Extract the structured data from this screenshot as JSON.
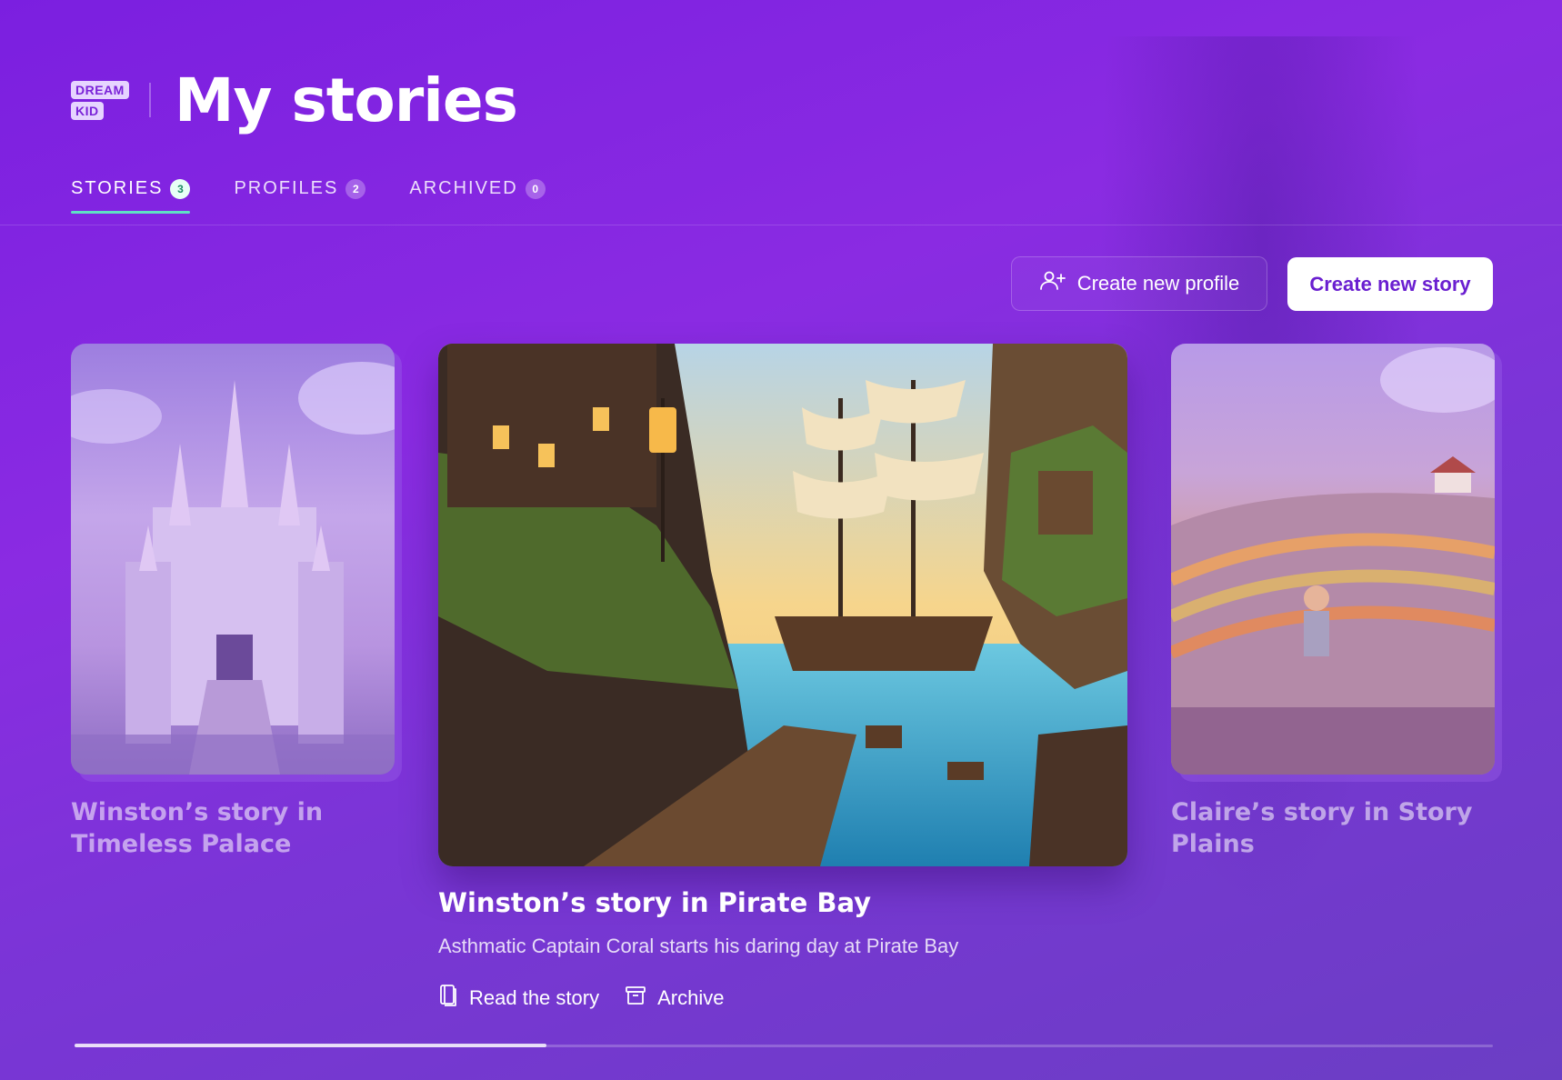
{
  "logo": {
    "line1": "DREAM",
    "line2": "KID"
  },
  "page_title": "My stories",
  "tabs": [
    {
      "label": "STORIES",
      "count": "3",
      "active": true
    },
    {
      "label": "PROFILES",
      "count": "2",
      "active": false
    },
    {
      "label": "ARCHIVED",
      "count": "0",
      "active": false
    }
  ],
  "buttons": {
    "create_profile": "Create new profile",
    "create_story": "Create new story"
  },
  "stories": [
    {
      "title": "Winston’s story in Timeless Palace"
    },
    {
      "title": "Winston’s story in Pirate Bay",
      "description": "Asthmatic Captain Coral starts his daring day at Pirate Bay"
    },
    {
      "title": "Claire’s story in Story Plains"
    }
  ],
  "actions": {
    "read": "Read the story",
    "archive": "Archive"
  },
  "carousel": {
    "progress": 0.333
  },
  "icons": {
    "profile": "user-plus-icon",
    "read": "book-icon",
    "archive": "archive-box-icon"
  },
  "colors": {
    "accent": "#5fe0c4",
    "primary_text_on_white": "#6a1fd0"
  }
}
